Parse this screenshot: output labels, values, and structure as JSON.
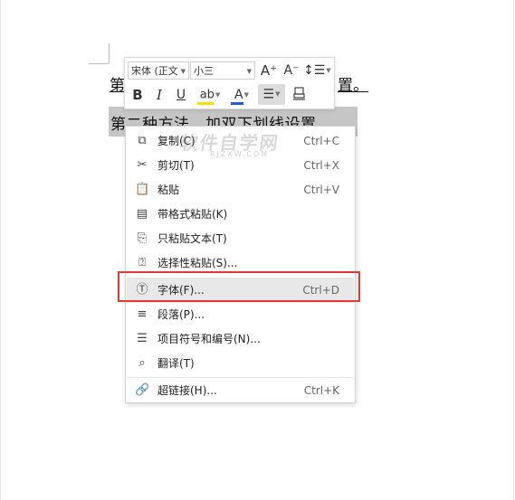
{
  "document": {
    "line1_start": "第",
    "line1_end": "置。",
    "line2": "第二种方法，加双下划线设置。"
  },
  "mini_toolbar": {
    "font_name": "宋体 (正文",
    "font_size": "小三",
    "grow_font": "A⁺",
    "shrink_font": "A⁻",
    "line_spacing": "↕☰",
    "bold": "B",
    "italic": "I",
    "underline": "U",
    "highlight": "ab",
    "font_color": "A",
    "align": "☰",
    "eraser": "⌫",
    "colors": {
      "highlight": "#f5e000",
      "font_color": "#2b54e8"
    }
  },
  "context_menu": {
    "items": [
      {
        "label": "复制(C)",
        "shortcut": "Ctrl+C",
        "icon": "copy-icon"
      },
      {
        "label": "剪切(T)",
        "shortcut": "Ctrl+X",
        "icon": "scissors-icon"
      },
      {
        "label": "粘贴",
        "shortcut": "Ctrl+V",
        "icon": "paste-icon"
      },
      {
        "label": "带格式粘贴(K)",
        "shortcut": "",
        "icon": "paste-formatted-icon"
      },
      {
        "label": "只粘贴文本(T)",
        "shortcut": "",
        "icon": "paste-text-icon"
      },
      {
        "label": "选择性粘贴(S)...",
        "shortcut": "",
        "icon": "paste-special-icon"
      },
      {
        "label": "字体(F)...",
        "shortcut": "Ctrl+D",
        "icon": "font-icon"
      },
      {
        "label": "段落(P)...",
        "shortcut": "",
        "icon": "paragraph-icon"
      },
      {
        "label": "项目符号和编号(N)...",
        "shortcut": "",
        "icon": "bullets-icon"
      },
      {
        "label": "翻译(T)",
        "shortcut": "",
        "icon": "translate-icon"
      },
      {
        "label": "超链接(H)...",
        "shortcut": "Ctrl+K",
        "icon": "link-icon"
      }
    ],
    "hovered_index": 6
  },
  "watermark": {
    "main": "软件自学网",
    "sub": "RJZXW.COM"
  }
}
